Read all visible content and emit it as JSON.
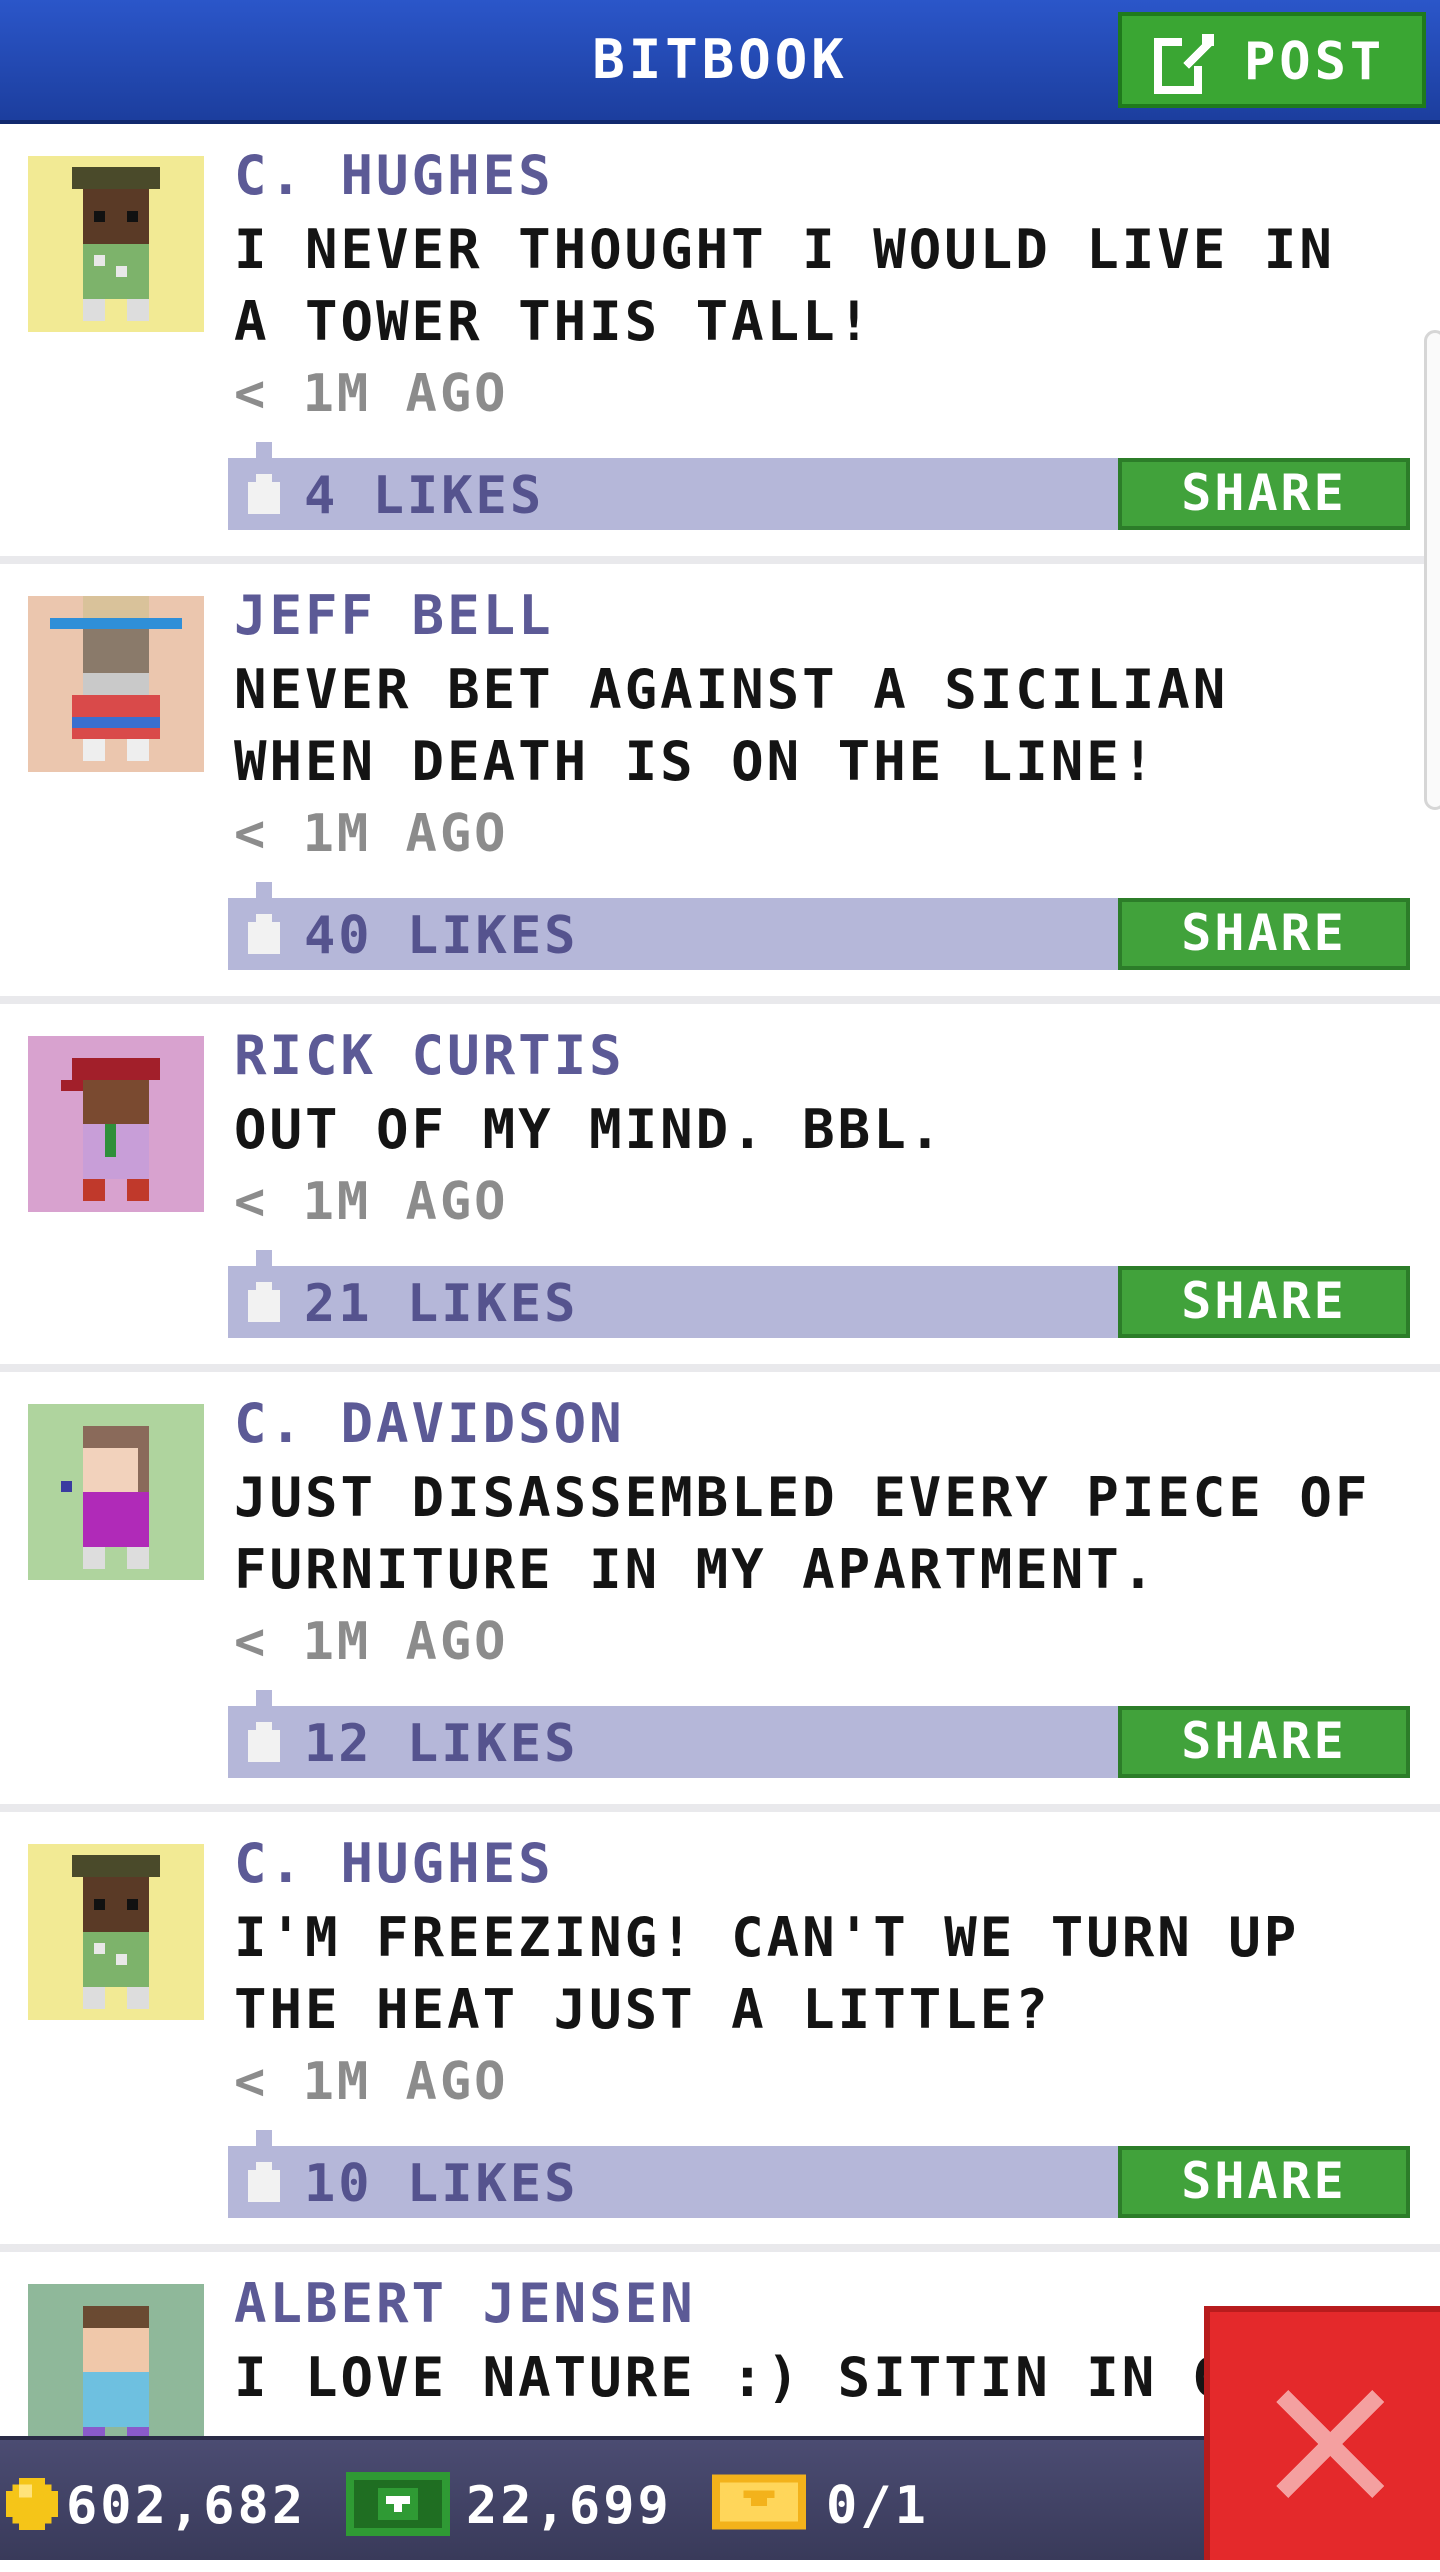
{
  "header": {
    "title": "BITBOOK",
    "post_label": "POST"
  },
  "posts": [
    {
      "author": "C. HUGHES",
      "message": "I NEVER THOUGHT I WOULD LIVE IN A TOWER THIS TALL!",
      "time": "< 1M AGO",
      "likes": "4 LIKES",
      "share": "SHARE"
    },
    {
      "author": "JEFF BELL",
      "message": "NEVER BET AGAINST A SICILIAN WHEN DEATH IS ON THE LINE!",
      "time": "< 1M AGO",
      "likes": "40 LIKES",
      "share": "SHARE"
    },
    {
      "author": "RICK CURTIS",
      "message": "OUT OF MY MIND. BBL.",
      "time": "< 1M AGO",
      "likes": "21 LIKES",
      "share": "SHARE"
    },
    {
      "author": "C. DAVIDSON",
      "message": "JUST DISASSEMBLED EVERY PIECE OF FURNITURE IN MY APARTMENT.",
      "time": "< 1M AGO",
      "likes": "12 LIKES",
      "share": "SHARE"
    },
    {
      "author": "C. HUGHES",
      "message": "I'M FREEZING! CAN'T WE TURN UP THE HEAT JUST A LITTLE?",
      "time": "< 1M AGO",
      "likes": "10 LIKES",
      "share": "SHARE"
    },
    {
      "author": "ALBERT JENSEN",
      "message": "I LOVE NATURE :) SITTIN IN GRAS"
    }
  ],
  "status_bar": {
    "coins": "602,682",
    "bux": "22,699",
    "tickets": "0/1"
  },
  "colors": {
    "header_blue": "#2b56c9",
    "share_green": "#41a23b",
    "like_bar": "#b5b7d9",
    "author_text": "#5c5a96",
    "close_red": "#e4292b"
  }
}
